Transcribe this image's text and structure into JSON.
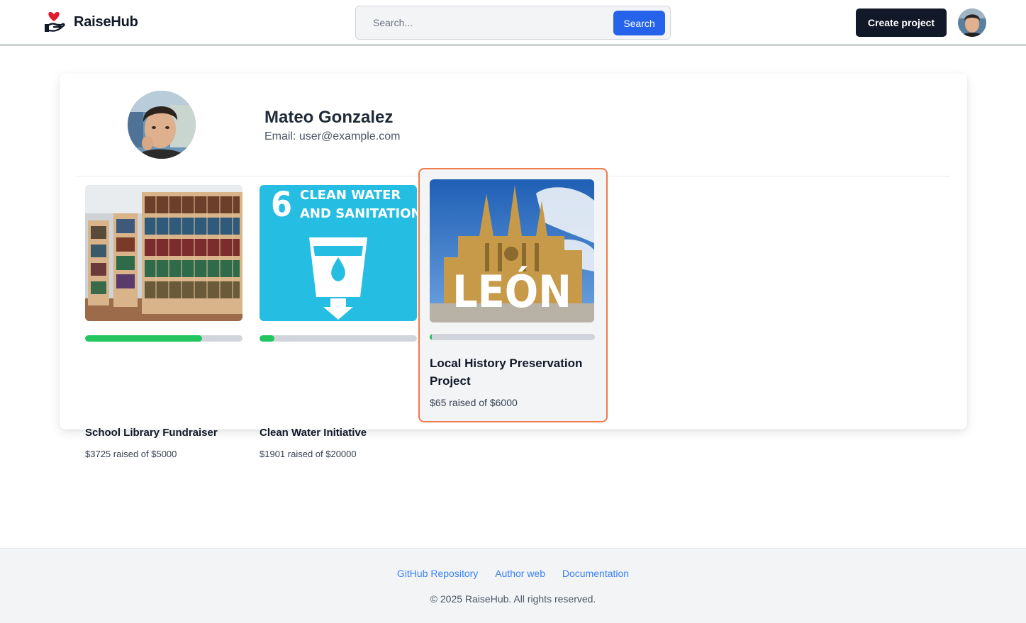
{
  "header": {
    "brand_name": "RaiseHub",
    "search_placeholder": "Search...",
    "search_button": "Search",
    "create_button": "Create project"
  },
  "profile": {
    "name": "Mateo Gonzalez",
    "email": "Email: user@example.com"
  },
  "projects": [
    {
      "title": "School Library Fundraiser",
      "raised": "$3725 raised of $5000",
      "progress": 0.745,
      "image": "bookshelves-image"
    },
    {
      "title": "Clean Water Initiative",
      "raised": "$1901 raised of $20000",
      "progress": 0.095,
      "image": "clean-water-sdg-image",
      "image_text_number": "6",
      "image_text_line1": "CLEAN WATER",
      "image_text_line2": "AND SANITATION"
    },
    {
      "title": "Local History Preservation Project",
      "raised": "$65 raised of $6000",
      "progress": 0.011,
      "image": "leon-cathedral-image",
      "image_text": "LEÓN"
    }
  ],
  "footer": {
    "links": [
      "GitHub Repository",
      "Author web",
      "Documentation"
    ],
    "copyright": "© 2025 RaiseHub. All rights reserved."
  },
  "colors": {
    "primary": "#2563eb",
    "dark": "#111827",
    "progress": "#22c55e",
    "highlight": "#ef7a4a",
    "link": "#3b82f6"
  }
}
